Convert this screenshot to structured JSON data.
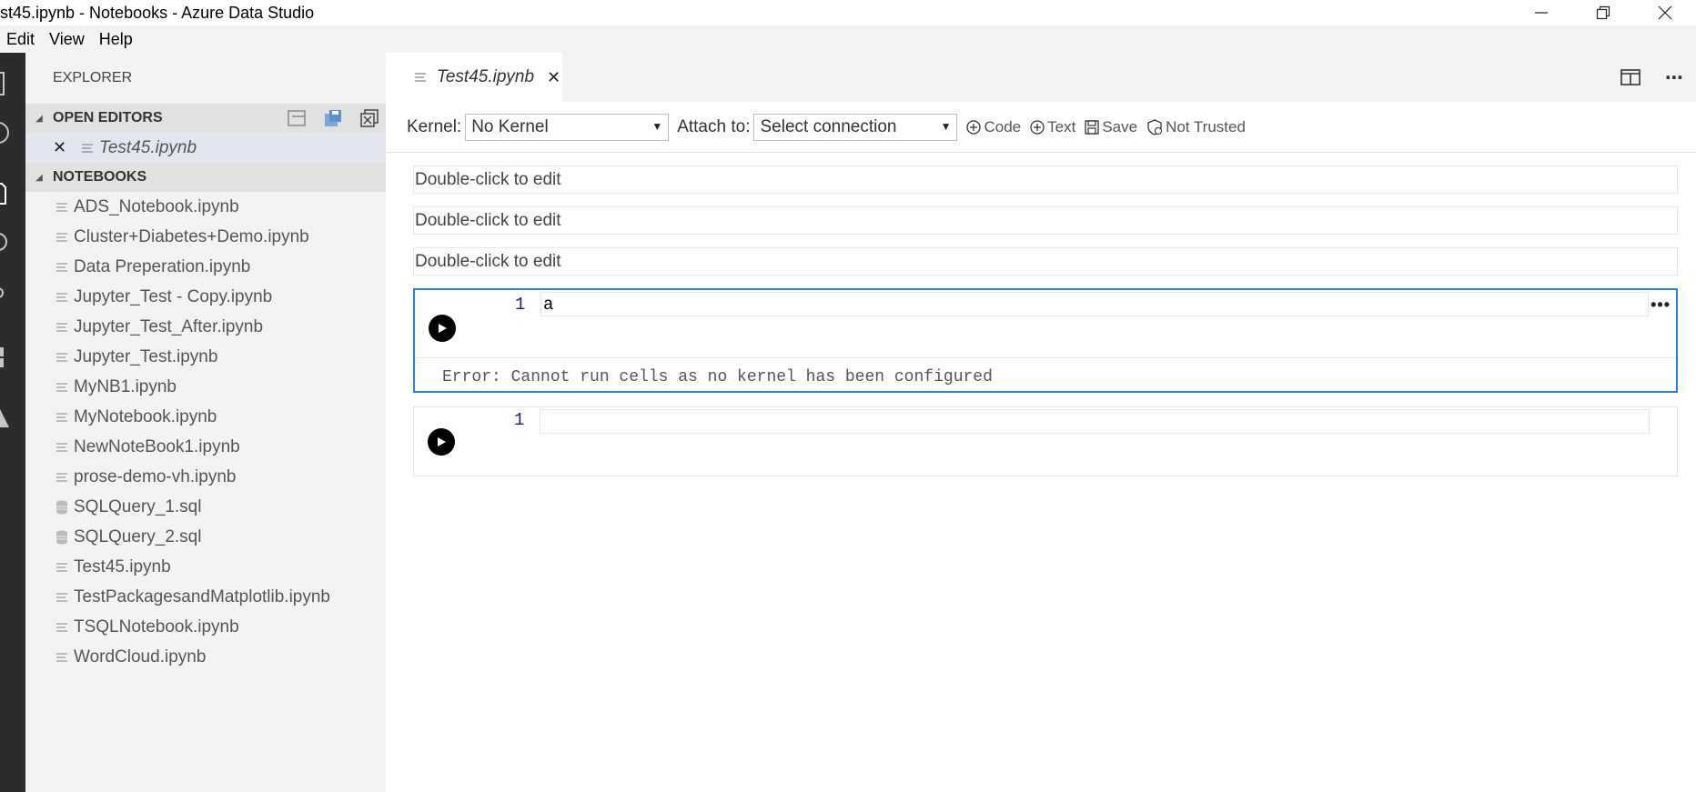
{
  "window": {
    "title": "st45.ipynb - Notebooks - Azure Data Studio",
    "minimize_icon": "minimize-icon",
    "restore_icon": "restore-icon",
    "close_icon": "close-icon"
  },
  "menu": [
    "Edit",
    "View",
    "Help"
  ],
  "sidebar": {
    "header": "EXPLORER",
    "open_editors": {
      "label": "OPEN EDITORS",
      "items": [
        {
          "name": "Test45.ipynb"
        }
      ]
    },
    "notebooks": {
      "label": "NOTEBOOKS",
      "files": [
        {
          "name": "ADS_Notebook.ipynb",
          "icon": "notebook-file-icon"
        },
        {
          "name": "Cluster+Diabetes+Demo.ipynb",
          "icon": "notebook-file-icon"
        },
        {
          "name": "Data Preperation.ipynb",
          "icon": "notebook-file-icon"
        },
        {
          "name": "Jupyter_Test - Copy.ipynb",
          "icon": "notebook-file-icon"
        },
        {
          "name": "Jupyter_Test_After.ipynb",
          "icon": "notebook-file-icon"
        },
        {
          "name": "Jupyter_Test.ipynb",
          "icon": "notebook-file-icon"
        },
        {
          "name": "MyNB1.ipynb",
          "icon": "notebook-file-icon"
        },
        {
          "name": "MyNotebook.ipynb",
          "icon": "notebook-file-icon"
        },
        {
          "name": "NewNoteBook1.ipynb",
          "icon": "notebook-file-icon"
        },
        {
          "name": "prose-demo-vh.ipynb",
          "icon": "notebook-file-icon"
        },
        {
          "name": "SQLQuery_1.sql",
          "icon": "database-file-icon"
        },
        {
          "name": "SQLQuery_2.sql",
          "icon": "database-file-icon"
        },
        {
          "name": "Test45.ipynb",
          "icon": "notebook-file-icon"
        },
        {
          "name": "TestPackagesandMatplotlib.ipynb",
          "icon": "notebook-file-icon"
        },
        {
          "name": "TSQLNotebook.ipynb",
          "icon": "notebook-file-icon"
        },
        {
          "name": "WordCloud.ipynb",
          "icon": "notebook-file-icon"
        }
      ]
    }
  },
  "editor": {
    "tab_label": "Test45.ipynb",
    "toolbar": {
      "kernel_label": "Kernel:",
      "kernel_value": "No Kernel",
      "attach_label": "Attach to:",
      "attach_value": "Select connection",
      "code_btn": "Code",
      "text_btn": "Text",
      "save_btn": "Save",
      "trust_btn": "Not Trusted"
    },
    "cells": {
      "markdown": [
        "Double-click to edit",
        "Double-click to edit",
        "Double-click to edit"
      ],
      "code1": {
        "line_no": "1",
        "source": "a",
        "output": "Error: Cannot run cells as no kernel has been configured"
      },
      "code2": {
        "line_no": "1",
        "source": ""
      }
    }
  }
}
